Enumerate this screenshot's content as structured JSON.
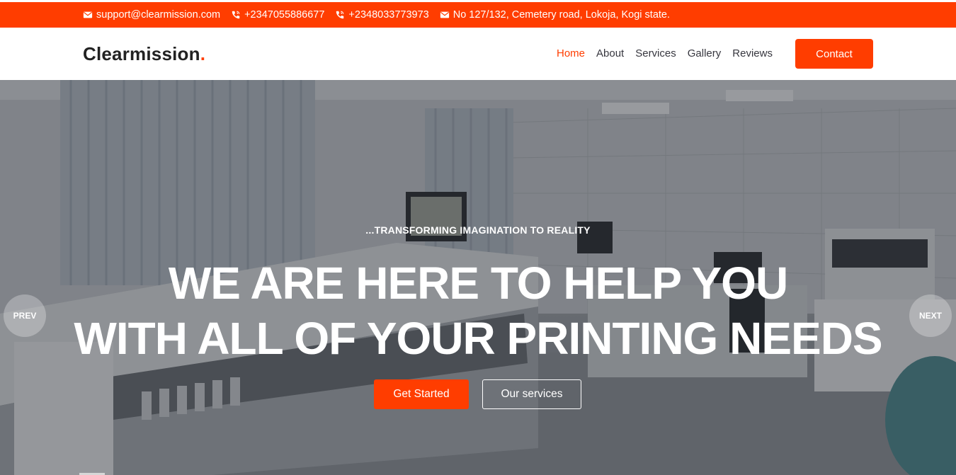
{
  "topbar": {
    "email": "support@clearmission.com",
    "phone1": "+2347055886677",
    "phone2": "+2348033773973",
    "address": "No 127/132, Cemetery road, Lokoja, Kogi state."
  },
  "header": {
    "logo": "Clearmission",
    "logo_dot": ".",
    "nav": [
      "Home",
      "About",
      "Services",
      "Gallery",
      "Reviews"
    ],
    "active_nav": "Home",
    "contact_label": "Contact"
  },
  "hero": {
    "tagline": "...TRANSFORMING IMAGINATION TO REALITY",
    "headline_line1": "WE ARE HERE TO HELP YOU",
    "headline_line2": "WITH ALL OF YOUR PRINTING NEEDS",
    "primary_button": "Get Started",
    "secondary_button": "Our services",
    "prev_label": "PREV",
    "next_label": "NEXT"
  },
  "colors": {
    "accent": "#ff3d00",
    "text_dark": "#222222",
    "nav_text": "#37373f"
  }
}
